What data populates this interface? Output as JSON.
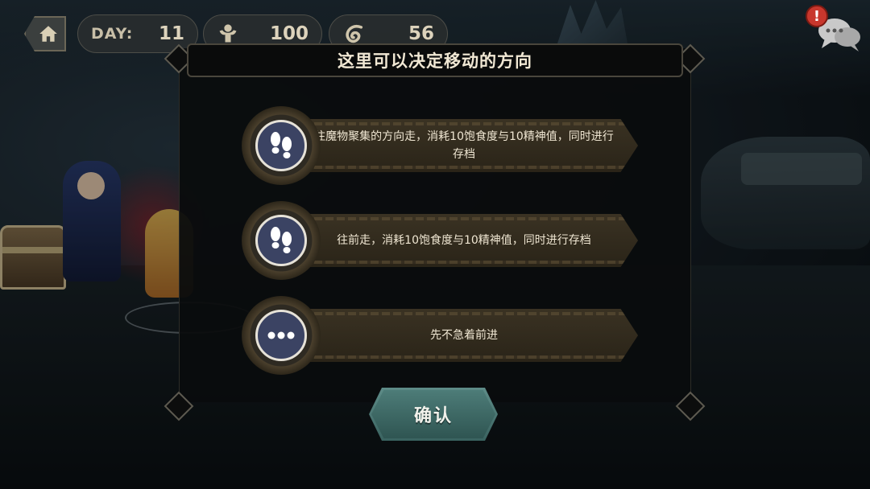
{
  "hud": {
    "day_label": "DAY:",
    "day_value": "11",
    "food_icon": "muscle-icon",
    "food_value": "100",
    "spirit_icon": "swirl-icon",
    "spirit_value": "56",
    "home_icon": "home-icon",
    "chat_icon": "chat-icon",
    "alert_badge": "!"
  },
  "dialog": {
    "title": "这里可以决定移动的方向",
    "options": [
      {
        "icon": "footprints-icon",
        "text": "往魔物聚集的方向走，消耗10饱食度与10精神值，同时进行存档"
      },
      {
        "icon": "footprints-icon",
        "text": "往前走，消耗10饱食度与10精神值，同时进行存档"
      },
      {
        "icon": "ellipsis-icon",
        "text": "先不急着前进"
      }
    ],
    "confirm_label": "确认"
  },
  "colors": {
    "accent_teal": "#4d7c78",
    "banner_brown": "#3a3223",
    "medal_blue": "#3b4363",
    "alert_red": "#c8372d"
  }
}
